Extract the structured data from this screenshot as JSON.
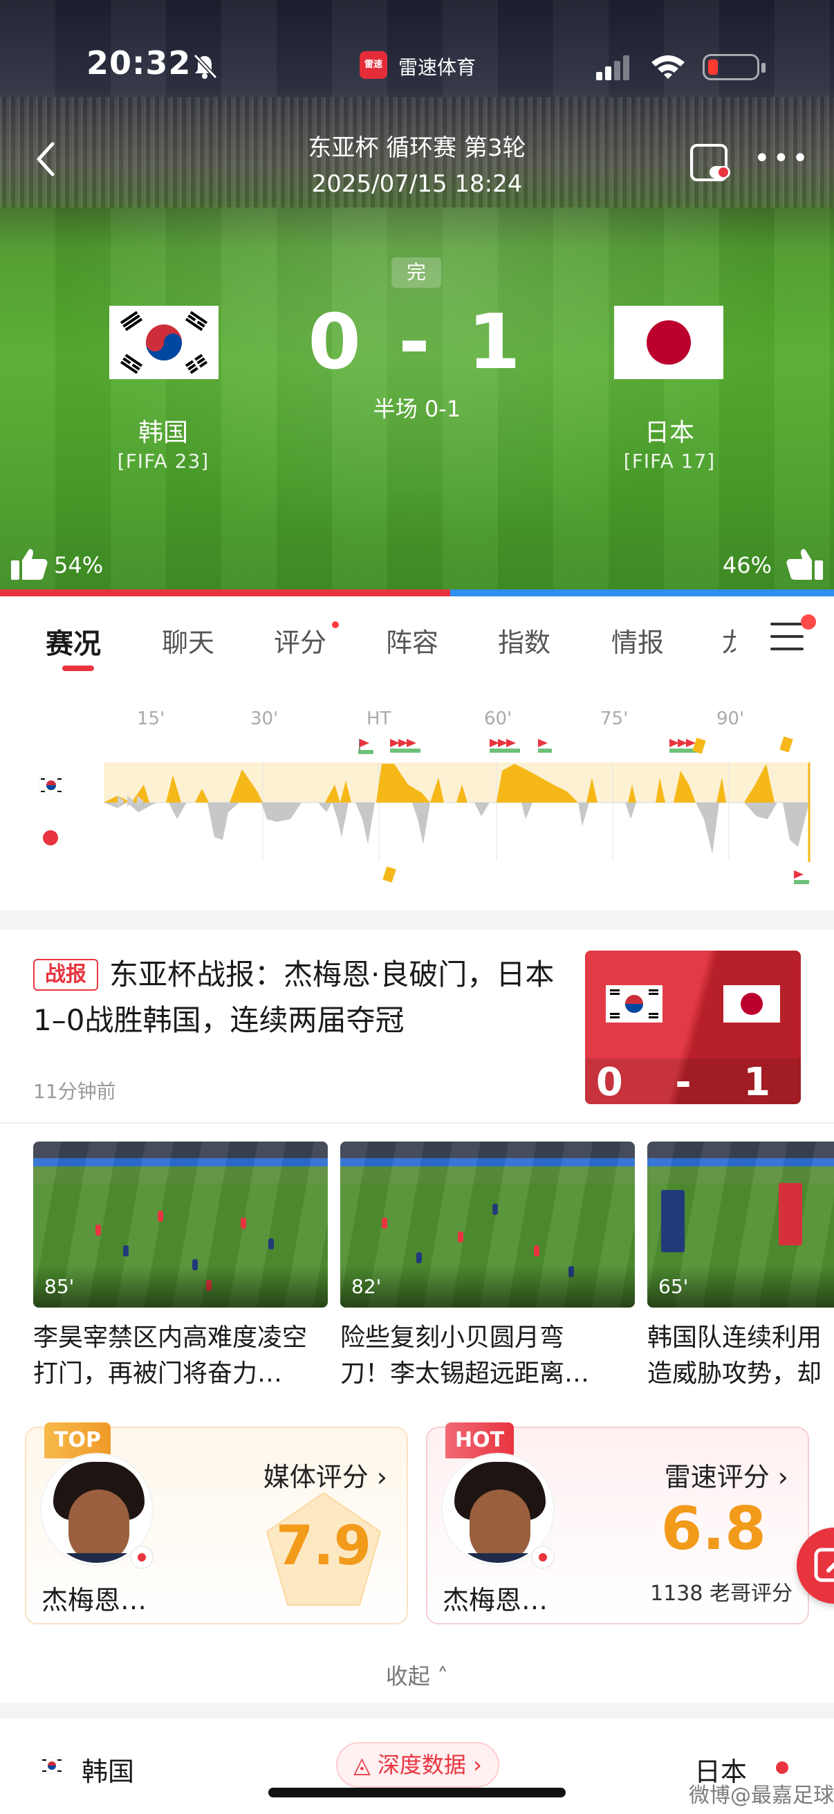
{
  "status_bar": {
    "time": "20:32",
    "app_name": "雷速体育",
    "app_badge": "雷速"
  },
  "match": {
    "league": "东亚杯 循环赛 第3轮",
    "datetime": "2025/07/15 18:24",
    "state": "完",
    "score": "0 - 1",
    "halftime": "半场 0-1",
    "home": {
      "name": "韩国",
      "rank": "[FIFA 23]",
      "support": "54%",
      "support_value": 54
    },
    "away": {
      "name": "日本",
      "rank": "[FIFA 17]",
      "support": "46%",
      "support_value": 46
    }
  },
  "tabs": [
    {
      "label": "赛况"
    },
    {
      "label": "聊天"
    },
    {
      "label": "评分"
    },
    {
      "label": "阵容"
    },
    {
      "label": "指数"
    },
    {
      "label": "情报"
    },
    {
      "label": "龙"
    }
  ],
  "timeline": {
    "ticks": [
      "15'",
      "30'",
      "HT",
      "60'",
      "75'",
      "90'"
    ],
    "colors": {
      "home": "#f5b818",
      "away": "#bdbdbd",
      "home_bg": "#fdf1d4"
    }
  },
  "news": {
    "tag": "战报",
    "title": "东亚杯战报：杰梅恩·良破门，日本1–0战胜韩国，连续两届夺冠",
    "time": "11分钟前",
    "score_card": "0 - 1"
  },
  "videos": [
    {
      "duration": "85'",
      "caption_line1": "李昊宰禁区内高难度凌空",
      "caption_line2": "打门，再被门将奋力…"
    },
    {
      "duration": "82'",
      "caption_line1": "险些复刻小贝圆月弯",
      "caption_line2": "刀！李太锡超远距离…"
    },
    {
      "duration": "65'",
      "caption_line1": "韩国队连续利用",
      "caption_line2": "造威胁攻势，却"
    }
  ],
  "ratings": {
    "media": {
      "badge": "TOP",
      "title": "媒体评分 ›",
      "player": "杰梅恩…",
      "score": "7.9"
    },
    "leisu": {
      "badge": "HOT",
      "title": "雷速评分 ›",
      "player": "杰梅恩…",
      "score": "6.8",
      "count": "1138 老哥评分"
    }
  },
  "collapse_label": "收起 ˄",
  "bottom_bar": {
    "home": "韩国",
    "button": "◬ 深度数据 ›",
    "away": "日本"
  },
  "watermark": "微博@最嘉足球"
}
